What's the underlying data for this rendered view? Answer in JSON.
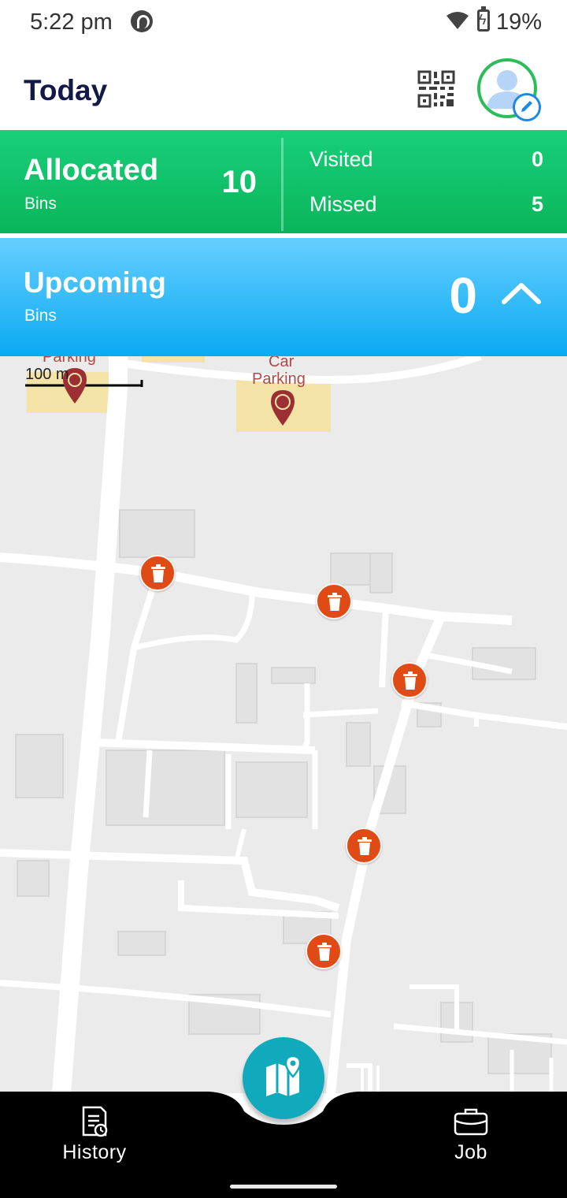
{
  "status_bar": {
    "time": "5:22 pm",
    "battery_percent": "19%",
    "icons": [
      "app-notification-icon",
      "wifi-icon",
      "battery-charging-icon"
    ]
  },
  "header": {
    "title": "Today",
    "icons": [
      "qr-code-icon",
      "avatar-icon",
      "edit-pencil-icon"
    ]
  },
  "allocated": {
    "title": "Allocated",
    "subtitle": "Bins",
    "count": "10",
    "visited_label": "Visited",
    "visited_value": "0",
    "missed_label": "Missed",
    "missed_value": "5"
  },
  "upcoming": {
    "title": "Upcoming",
    "subtitle": "Bins",
    "count": "0",
    "toggle_icon": "chevron-up-icon"
  },
  "map": {
    "scale_label": "100 m",
    "labels": {
      "parking_top_left": "Parking",
      "car_parking_l1": "Car",
      "car_parking_l2": "Parking"
    },
    "bin_pin_count": 5,
    "bin_icon": "trash-bin-icon"
  },
  "bottom_nav": {
    "history_label": "History",
    "job_label": "Job",
    "fab_icon": "map-pin-icon"
  },
  "colors": {
    "allocated_green": "#0fc268",
    "upcoming_blue": "#1fb4f5",
    "pin_orange": "#e04a15",
    "fab_teal": "#11aabd",
    "title_navy": "#121848"
  }
}
